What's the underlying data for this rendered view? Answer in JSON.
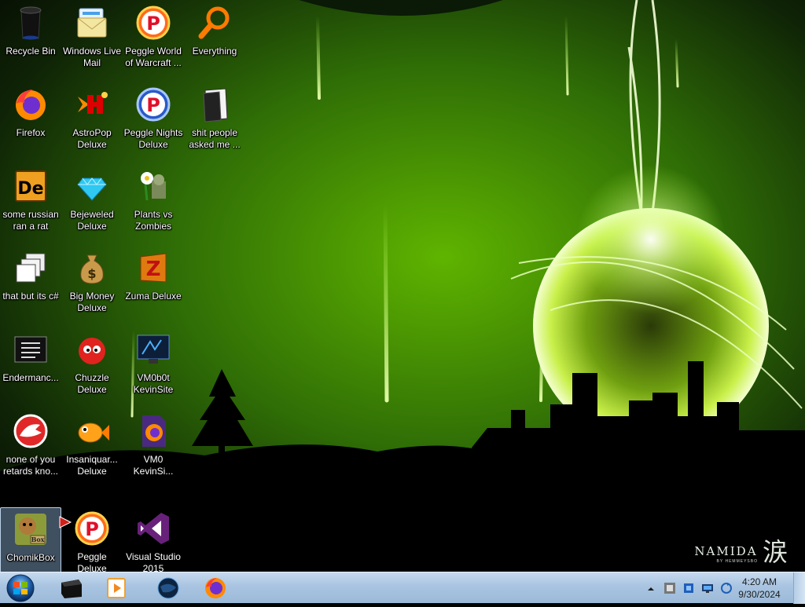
{
  "desktop": {
    "icons": [
      {
        "label": "Recycle Bin",
        "icon": "recycle-bin-icon"
      },
      {
        "label": "Firefox",
        "icon": "firefox-icon"
      },
      {
        "label": "some russian ran a rat",
        "icon": "de-file-icon"
      },
      {
        "label": "that but its c#",
        "icon": "windows-stack-icon"
      },
      {
        "label": "Endermanc...",
        "icon": "console-window-icon"
      },
      {
        "label": "none of you retards kno...",
        "icon": "red-dinosaur-icon"
      },
      {
        "label": "ChomikBox",
        "icon": "chomikbox-icon",
        "selected": true
      },
      {
        "label": "Windows Live Mail",
        "icon": "windows-live-mail-icon"
      },
      {
        "label": "AstroPop Deluxe",
        "icon": "astropop-icon"
      },
      {
        "label": "Bejeweled Deluxe",
        "icon": "bejeweled-gem-icon"
      },
      {
        "label": "Big Money Deluxe",
        "icon": "money-bag-icon"
      },
      {
        "label": "Chuzzle Deluxe",
        "icon": "chuzzle-icon"
      },
      {
        "label": "Insaniquar... Deluxe",
        "icon": "insaniquarium-fish-icon"
      },
      {
        "label": "Peggle Deluxe",
        "icon": "peggle-icon"
      },
      {
        "label": "Peggle World of Warcraft ...",
        "icon": "peggle-icon"
      },
      {
        "label": "Peggle Nights Deluxe",
        "icon": "peggle-nights-icon"
      },
      {
        "label": "Plants vs Zombies",
        "icon": "plants-vs-zombies-icon"
      },
      {
        "label": "Zuma Deluxe",
        "icon": "zuma-icon"
      },
      {
        "label": "VM0b0t KevinSite",
        "icon": "monitor-shortcut-icon"
      },
      {
        "label": "VM0 KevinSi...",
        "icon": "firefox-document-icon"
      },
      {
        "label": "Visual Studio 2015",
        "icon": "visual-studio-icon"
      },
      {
        "label": "Everything",
        "icon": "magnifier-icon"
      },
      {
        "label": "shit people asked me ...",
        "icon": "document-folder-icon"
      }
    ]
  },
  "wallpaper": {
    "brand_name": "NAMIDA",
    "brand_kanji": "涙",
    "brand_by": "BY HEMMEYSBO",
    "accent": "#7fe000"
  },
  "taskbar": {
    "start_icon": "windows-start-orb-icon",
    "pinned": [
      {
        "icon": "black-box-icon"
      },
      {
        "icon": "media-player-icon"
      },
      {
        "icon": "dark-globe-icon"
      },
      {
        "icon": "firefox-icon"
      }
    ],
    "tray": [
      {
        "icon": "show-hidden-icons-chevron-icon"
      },
      {
        "icon": "tray-app-icon"
      },
      {
        "icon": "tray-shield-icon"
      },
      {
        "icon": "tray-network-icon"
      },
      {
        "icon": "tray-refresh-icon"
      }
    ],
    "time": "4:20 AM",
    "date": "9/30/2024",
    "colors": {
      "bar": "#a8c4e1"
    }
  }
}
